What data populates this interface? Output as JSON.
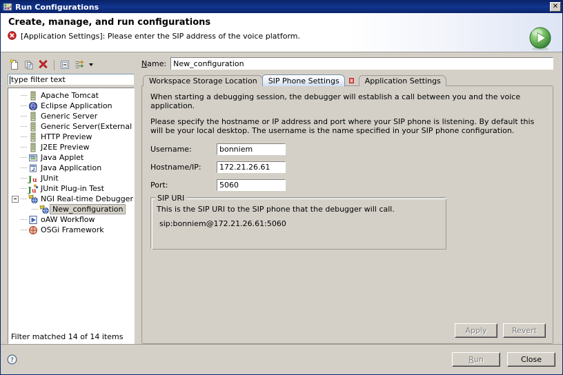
{
  "window": {
    "title": "Run Configurations",
    "close_label": "✕",
    "icon": "run-configurations-icon"
  },
  "header": {
    "title": "Create, manage, and run configurations",
    "message": "[Application Settings]: Please enter the SIP address of the voice platform.",
    "message_icon": "error-icon",
    "badge_icon": "run-green-play-icon"
  },
  "toolbar": {
    "buttons": [
      {
        "name": "new-configuration-button",
        "icon": "new-document-icon"
      },
      {
        "name": "duplicate-configuration-button",
        "icon": "copy-document-icon"
      },
      {
        "name": "delete-configuration-button",
        "icon": "red-x-delete-icon"
      },
      {
        "name": "collapse-all-button",
        "icon": "collapse-all-icon"
      },
      {
        "name": "filter-configurations-button",
        "icon": "filter-arrows-icon"
      }
    ]
  },
  "filter": {
    "placeholder": "type filter text",
    "value": "type filter text"
  },
  "tree": {
    "status": "Filter matched 14 of 14 items",
    "items": [
      {
        "label": "Apache Tomcat",
        "icon": "server-icon",
        "level": 0,
        "selected": false,
        "expander": false
      },
      {
        "label": "Eclipse Application",
        "icon": "eclipse-globe-icon",
        "level": 0,
        "selected": false,
        "expander": false
      },
      {
        "label": "Generic Server",
        "icon": "server-icon",
        "level": 0,
        "selected": false,
        "expander": false
      },
      {
        "label": "Generic Server(External Launch)",
        "icon": "server-icon",
        "level": 0,
        "selected": false,
        "expander": false
      },
      {
        "label": "HTTP Preview",
        "icon": "server-icon",
        "level": 0,
        "selected": false,
        "expander": false
      },
      {
        "label": "J2EE Preview",
        "icon": "server-icon",
        "level": 0,
        "selected": false,
        "expander": false
      },
      {
        "label": "Java Applet",
        "icon": "java-applet-icon",
        "level": 0,
        "selected": false,
        "expander": false
      },
      {
        "label": "Java Application",
        "icon": "java-application-icon",
        "level": 0,
        "selected": false,
        "expander": false
      },
      {
        "label": "JUnit",
        "icon": "junit-icon",
        "level": 0,
        "selected": false,
        "expander": false
      },
      {
        "label": "JUnit Plug-in Test",
        "icon": "junit-plugin-icon",
        "level": 0,
        "selected": false,
        "expander": false
      },
      {
        "label": "NGI Real-time Debugger",
        "icon": "debugger-bug-icon",
        "level": 0,
        "selected": false,
        "expander": true
      },
      {
        "label": "New_configuration",
        "icon": "debugger-bug-icon",
        "level": 1,
        "selected": true,
        "expander": false
      },
      {
        "label": "oAW Workflow",
        "icon": "blue-play-icon",
        "level": 0,
        "selected": false,
        "expander": false
      },
      {
        "label": "OSGi Framework",
        "icon": "osgi-icon",
        "level": 0,
        "selected": false,
        "expander": false
      }
    ]
  },
  "config": {
    "name_label": "Name:",
    "name_value": "New_configuration"
  },
  "tabs": [
    {
      "label": "Workspace Storage Location",
      "active": false,
      "error": false
    },
    {
      "label": "SIP Phone Settings",
      "active": true,
      "error": false
    },
    {
      "label": "Application Settings",
      "active": false,
      "error": true
    }
  ],
  "panel": {
    "paragraph1": "When starting a debugging session, the debugger will establish a call between you and the voice application.",
    "paragraph2": "Please specify the hostname or IP address and port where your SIP phone is listening.  By default this will be your local desktop.  The username is the name specified in your SIP phone configuration.",
    "fields": [
      {
        "label": "Username:",
        "value": "bonniem",
        "name": "username-field"
      },
      {
        "label": "Hostname/IP:",
        "value": "172.21.26.61",
        "name": "hostname-ip-field"
      },
      {
        "label": "Port:",
        "value": "5060",
        "name": "port-field"
      }
    ],
    "group": {
      "legend": "SIP URI",
      "description": "This is the SIP URI to the SIP phone that the debugger will call.",
      "uri": "sip:bonniem@172.21.26.61:5060"
    },
    "apply_label": "Apply",
    "revert_label": "Revert"
  },
  "footer": {
    "help_icon": "help-question-icon",
    "run_label": "Run",
    "close_label": "Close"
  }
}
